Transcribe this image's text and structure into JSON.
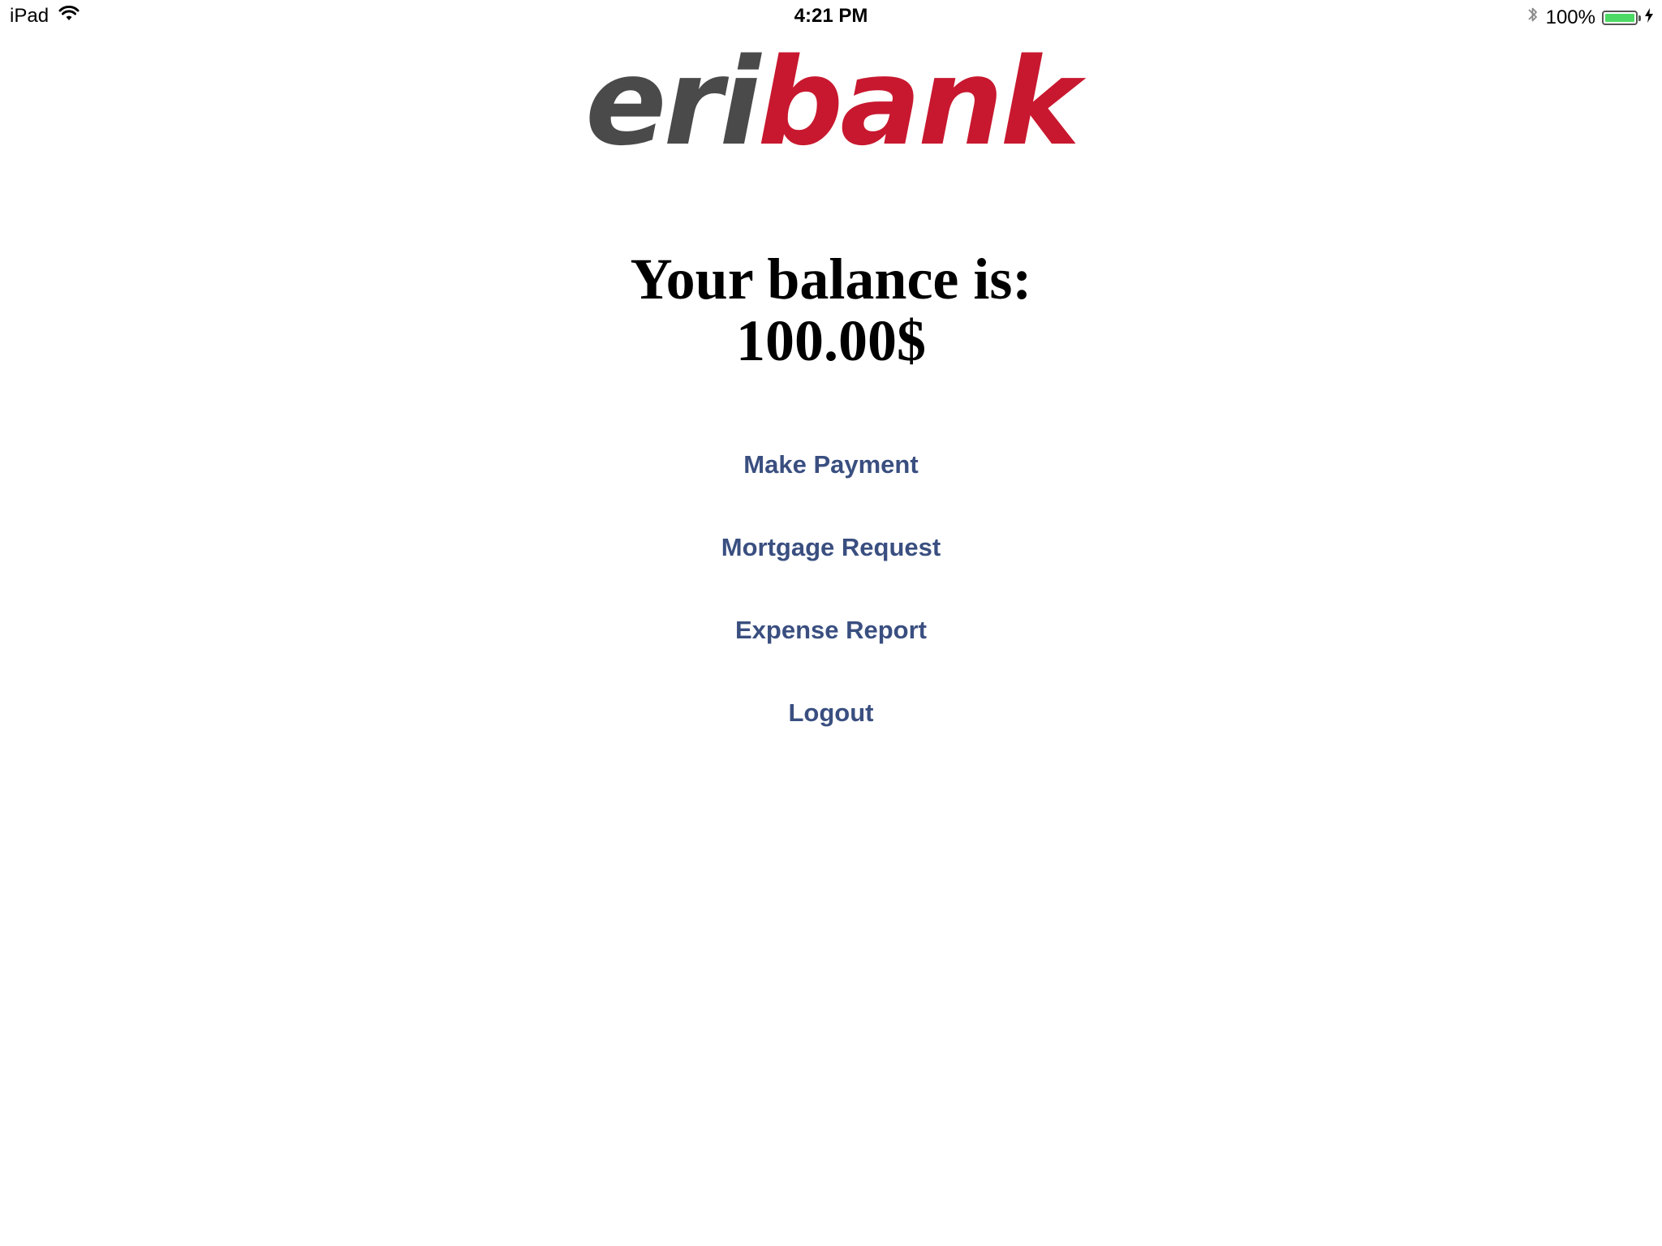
{
  "status_bar": {
    "device": "iPad",
    "time": "4:21 PM",
    "battery_percent": "100%",
    "battery_level": 1.0,
    "icons": [
      "wifi-icon",
      "bluetooth-icon",
      "battery-icon",
      "charging-bolt-icon"
    ]
  },
  "logo": {
    "part1": "eri",
    "part2": "bank",
    "colors": {
      "part1": "#4a4a4a",
      "part2": "#c8182f"
    }
  },
  "balance": {
    "label": "Your balance is:",
    "amount": "100.00$"
  },
  "menu": {
    "items": [
      {
        "label": "Make Payment"
      },
      {
        "label": "Mortgage Request"
      },
      {
        "label": "Expense Report"
      },
      {
        "label": "Logout"
      }
    ],
    "link_color": "#3a4f80"
  }
}
